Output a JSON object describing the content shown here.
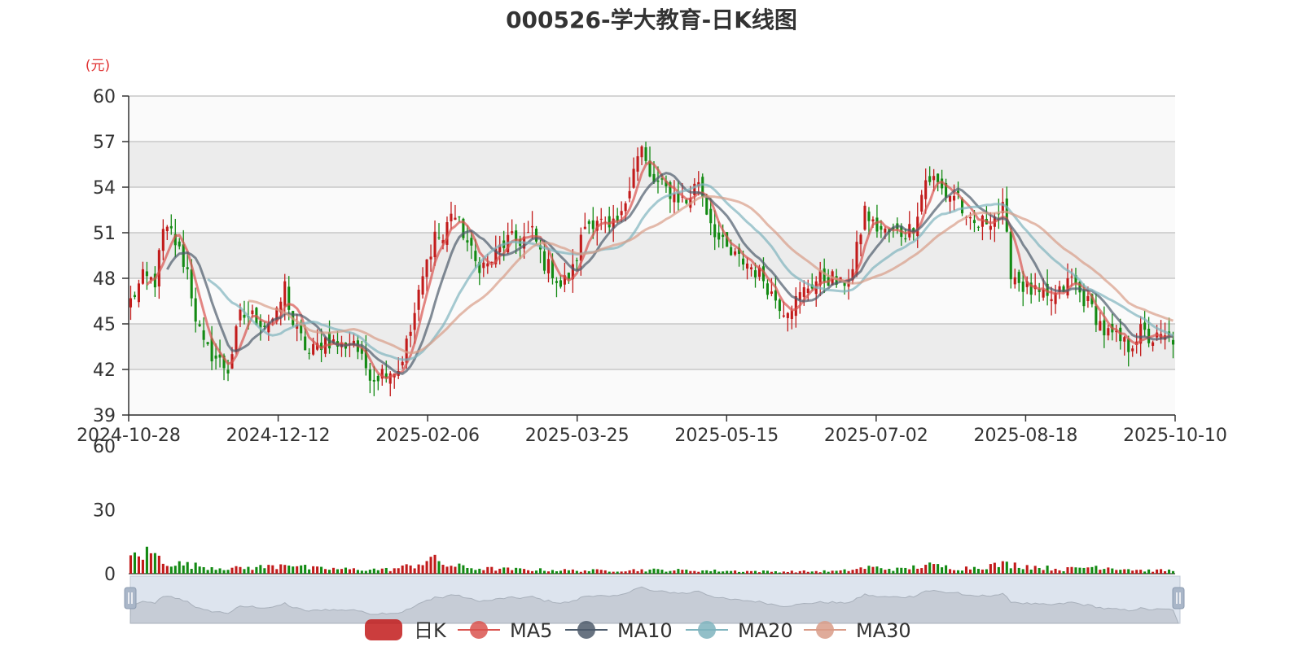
{
  "title": "000526-学大教育-日K线图",
  "unit_label": "(元)",
  "colors": {
    "up": "#c21b1b",
    "down": "#138a13",
    "ma5": "#d9534f",
    "ma10": "#4d5b6b",
    "ma20": "#7fb4be",
    "ma30": "#d99c88",
    "slider_bg": "#dde4ee",
    "slider_area": "#a8b0bb"
  },
  "legend": [
    {
      "label": "日K",
      "color": "#c21b1b",
      "icon": "roundrect-icon"
    },
    {
      "label": "MA5",
      "color": "#d9534f",
      "icon": "line-circle-icon"
    },
    {
      "label": "MA10",
      "color": "#4d5b6b",
      "icon": "line-circle-icon"
    },
    {
      "label": "MA20",
      "color": "#7fb4be",
      "icon": "line-circle-icon"
    },
    {
      "label": "MA30",
      "color": "#d99c88",
      "icon": "line-circle-icon"
    }
  ],
  "chart_data": [
    {
      "type": "candlestick",
      "title": "000526-学大教育-日K线图",
      "ylabel": "(元)",
      "ylim": [
        39,
        60
      ],
      "y_ticks": [
        "39",
        "42",
        "45",
        "48",
        "51",
        "54",
        "57",
        "60"
      ],
      "x_ticks": [
        "2024-10-28",
        "2024-12-12",
        "2025-02-06",
        "2025-03-25",
        "2025-05-15",
        "2025-07-02",
        "2025-08-18",
        "2025-10-10"
      ],
      "grid": true,
      "legend_position": "bottom",
      "close_anchors": [
        [
          0,
          46.5
        ],
        [
          3,
          48.0
        ],
        [
          6,
          47.8
        ],
        [
          8,
          51.0
        ],
        [
          10,
          51.0
        ],
        [
          14,
          48.5
        ],
        [
          16,
          45.5
        ],
        [
          18,
          43.5
        ],
        [
          22,
          42.5
        ],
        [
          24,
          42.0
        ],
        [
          27,
          45.5
        ],
        [
          30,
          45.5
        ],
        [
          33,
          45.0
        ],
        [
          36,
          45.5
        ],
        [
          38,
          47.5
        ],
        [
          40,
          45.0
        ],
        [
          44,
          43.0
        ],
        [
          48,
          44.0
        ],
        [
          52,
          43.5
        ],
        [
          55,
          44.0
        ],
        [
          57,
          42.5
        ],
        [
          60,
          41.5
        ],
        [
          63,
          42.0
        ],
        [
          66,
          42.0
        ],
        [
          69,
          44.5
        ],
        [
          72,
          48.0
        ],
        [
          75,
          51.0
        ],
        [
          77,
          50.5
        ],
        [
          79,
          52.5
        ],
        [
          82,
          51.0
        ],
        [
          85,
          49.0
        ],
        [
          88,
          48.8
        ],
        [
          91,
          50.0
        ],
        [
          93,
          50.5
        ],
        [
          96,
          50.5
        ],
        [
          99,
          51.0
        ],
        [
          102,
          49.0
        ],
        [
          104,
          48.5
        ],
        [
          106,
          47.5
        ],
        [
          109,
          48.5
        ],
        [
          112,
          51.5
        ],
        [
          115,
          52.0
        ],
        [
          118,
          51.0
        ],
        [
          121,
          52.0
        ],
        [
          124,
          55.5
        ],
        [
          126,
          56.5
        ],
        [
          128,
          54.5
        ],
        [
          131,
          54.0
        ],
        [
          134,
          53.5
        ],
        [
          137,
          53.0
        ],
        [
          140,
          54.5
        ],
        [
          142,
          52.5
        ],
        [
          145,
          50.5
        ],
        [
          148,
          49.5
        ],
        [
          152,
          49.0
        ],
        [
          156,
          48.0
        ],
        [
          158,
          47.0
        ],
        [
          161,
          46.0
        ],
        [
          164,
          46.5
        ],
        [
          167,
          47.5
        ],
        [
          170,
          48.0
        ],
        [
          173,
          48.0
        ],
        [
          175,
          47.5
        ],
        [
          178,
          48.5
        ],
        [
          181,
          52.5
        ],
        [
          183,
          51.5
        ],
        [
          186,
          51.0
        ],
        [
          189,
          51.0
        ],
        [
          191,
          51.0
        ],
        [
          193,
          51.5
        ],
        [
          196,
          54.5
        ],
        [
          198,
          54.5
        ],
        [
          201,
          53.5
        ],
        [
          204,
          53.5
        ],
        [
          206,
          51.5
        ],
        [
          209,
          51.5
        ],
        [
          212,
          52.0
        ],
        [
          215,
          52.5
        ],
        [
          217,
          48.5
        ],
        [
          220,
          47.5
        ],
        [
          223,
          47.0
        ],
        [
          226,
          46.5
        ],
        [
          229,
          47.0
        ],
        [
          232,
          48.0
        ],
        [
          234,
          47.0
        ],
        [
          237,
          46.0
        ],
        [
          240,
          44.5
        ],
        [
          243,
          44.0
        ],
        [
          246,
          43.5
        ],
        [
          249,
          44.5
        ],
        [
          251,
          44.0
        ],
        [
          254,
          44.0
        ],
        [
          257,
          44.0
        ]
      ],
      "moving_averages": [
        "MA5",
        "MA10",
        "MA20",
        "MA30"
      ]
    },
    {
      "type": "bar",
      "title": "",
      "ylim": [
        0,
        60
      ],
      "y_ticks": [
        "0",
        "30",
        "60"
      ],
      "volume_anchors": [
        [
          0,
          8.0
        ],
        [
          5,
          10.0
        ],
        [
          8,
          6.0
        ],
        [
          12,
          4.5
        ],
        [
          20,
          3.0
        ],
        [
          26,
          2.5
        ],
        [
          36,
          3.5
        ],
        [
          38,
          5.5
        ],
        [
          44,
          2.5
        ],
        [
          56,
          2.0
        ],
        [
          64,
          2.0
        ],
        [
          70,
          4.0
        ],
        [
          74,
          7.0
        ],
        [
          78,
          4.0
        ],
        [
          85,
          2.5
        ],
        [
          95,
          2.0
        ],
        [
          110,
          1.5
        ],
        [
          118,
          1.5
        ],
        [
          126,
          1.8
        ],
        [
          140,
          1.5
        ],
        [
          160,
          1.0
        ],
        [
          175,
          1.2
        ],
        [
          182,
          3.0
        ],
        [
          190,
          2.0
        ],
        [
          196,
          4.0
        ],
        [
          205,
          2.5
        ],
        [
          216,
          4.5
        ],
        [
          230,
          2.0
        ],
        [
          238,
          3.5
        ],
        [
          250,
          1.5
        ],
        [
          257,
          1.5
        ]
      ]
    }
  ]
}
